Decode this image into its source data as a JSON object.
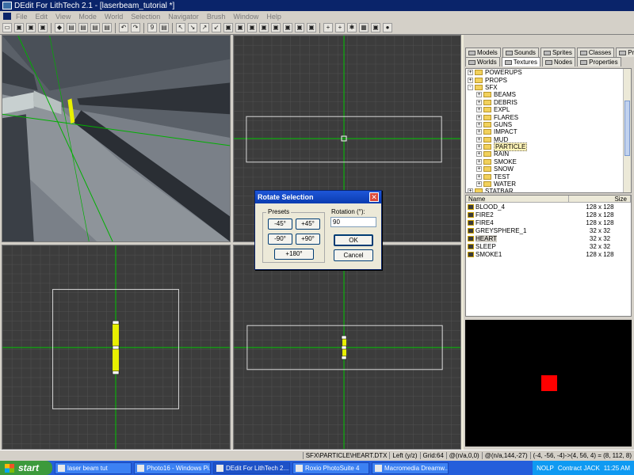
{
  "window": {
    "title": "DEdit For LithTech 2.1 - [laserbeam_tutorial *]"
  },
  "menu": [
    "File",
    "Edit",
    "View",
    "Mode",
    "World",
    "Selection",
    "Navigator",
    "Brush",
    "Window",
    "Help"
  ],
  "toolbar_glyphs": [
    "▭",
    "▣",
    "▣",
    "▣",
    "◆",
    "▤",
    "▤",
    "▤",
    "▤",
    "↶",
    "↷",
    "9",
    "▤",
    "↖",
    "↘",
    "↗",
    "↙",
    "▣",
    "▣",
    "▣",
    "▣",
    "▣",
    "▣",
    "▣",
    "▣",
    "+",
    "+",
    "✱",
    "▦",
    "▣",
    "●"
  ],
  "panel": {
    "tabs_row1": [
      "Models",
      "Sounds",
      "Sprites",
      "Classes",
      "Prefabs"
    ],
    "tabs_row2": [
      "Worlds",
      "Textures",
      "Nodes",
      "Properties"
    ],
    "active_tab": "Textures",
    "tree": [
      {
        "label": "POWERUPS",
        "indent": 0,
        "toggle": "+"
      },
      {
        "label": "PROPS",
        "indent": 0,
        "toggle": "+"
      },
      {
        "label": "SFX",
        "indent": 0,
        "toggle": "-"
      },
      {
        "label": "BEAMS",
        "indent": 1,
        "toggle": "+"
      },
      {
        "label": "DEBRIS",
        "indent": 1,
        "toggle": "+"
      },
      {
        "label": "EXPL",
        "indent": 1,
        "toggle": "+"
      },
      {
        "label": "FLARES",
        "indent": 1,
        "toggle": "+"
      },
      {
        "label": "GUNS",
        "indent": 1,
        "toggle": "+"
      },
      {
        "label": "IMPACT",
        "indent": 1,
        "toggle": "+"
      },
      {
        "label": "MUD",
        "indent": 1,
        "toggle": "+"
      },
      {
        "label": "PARTICLE",
        "indent": 1,
        "toggle": "+",
        "selected": true
      },
      {
        "label": "RAIN",
        "indent": 1,
        "toggle": "+"
      },
      {
        "label": "SMOKE",
        "indent": 1,
        "toggle": "+"
      },
      {
        "label": "SNOW",
        "indent": 1,
        "toggle": "+"
      },
      {
        "label": "TEST",
        "indent": 1,
        "toggle": "+"
      },
      {
        "label": "WATER",
        "indent": 1,
        "toggle": "+"
      },
      {
        "label": "STATBAR",
        "indent": 0,
        "toggle": "+"
      }
    ],
    "file_list": {
      "columns": [
        "Name",
        "Size"
      ],
      "rows": [
        {
          "name": "BLOOD_4",
          "size": "128 x 128"
        },
        {
          "name": "FIRE2",
          "size": "128 x 128"
        },
        {
          "name": "FIRE4",
          "size": "128 x 128"
        },
        {
          "name": "GREYSPHERE_1",
          "size": "32 x 32"
        },
        {
          "name": "HEART",
          "size": "32 x 32",
          "selected": true
        },
        {
          "name": "SLEEP",
          "size": "32 x 32"
        },
        {
          "name": "SMOKE1",
          "size": "128 x 128"
        }
      ]
    },
    "preview_color": "#ff0000"
  },
  "dialog": {
    "title": "Rotate Selection",
    "close": "✕",
    "presets_label": "Presets",
    "presets": [
      "-45°",
      "+45°",
      "-90°",
      "+90°",
      "+180°"
    ],
    "rotation_label": "Rotation (°):",
    "rotation_value": "90",
    "ok": "OK",
    "cancel": "Cancel"
  },
  "status": [
    "SFX\\PARTICLE\\HEART.DTX",
    "Left (y/z)",
    "Grid:64",
    "@(n/a,0,0)",
    "@(n/a,144,-27)",
    "(-4, -56, -4)->(4, 56, 4) = (8, 112, 8)"
  ],
  "taskbar": {
    "start": "start",
    "items": [
      "laser beam tut",
      "Photo16 - Windows Pi...",
      "DEdit For LithTech 2....",
      "Roxio PhotoSuite 4",
      "Macromedia Dreamw..."
    ],
    "active_index": 2,
    "tray": [
      "NOLP",
      "Contract JACK"
    ],
    "time": "11:25 AM"
  },
  "colors": {
    "grid_bg": "#3c3c3c",
    "axis": "#00c800",
    "selection": "#e8e800",
    "brush_outline": "#d8d8d8"
  }
}
